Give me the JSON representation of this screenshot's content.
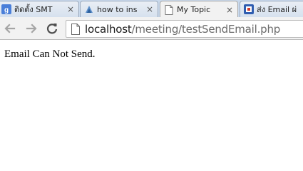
{
  "browser": {
    "tabs": [
      {
        "title": "ติดตั้ง SMT",
        "icon": "google-icon",
        "active": false
      },
      {
        "title": "how to ins",
        "icon": "stackoverflow-icon",
        "active": false
      },
      {
        "title": "My Topic",
        "icon": "page-icon",
        "active": true
      },
      {
        "title": "ส่ง Email ผ่",
        "icon": "thai-site-icon",
        "active": false
      }
    ],
    "tab_close_symbol": "×",
    "toolbar": {
      "back_icon": "back-arrow-icon",
      "forward_icon": "forward-arrow-icon",
      "reload_icon": "reload-icon"
    },
    "address": {
      "host": "localhost",
      "path": "/meeting/testSendEmail.php"
    }
  },
  "page": {
    "message": "Email Can Not Send."
  }
}
